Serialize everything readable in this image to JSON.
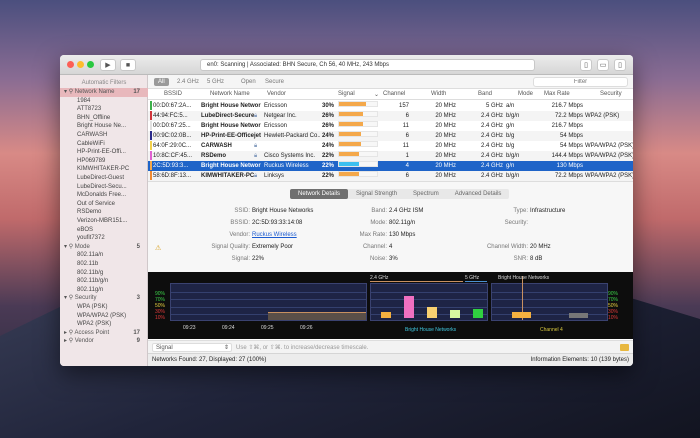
{
  "toolbar": {
    "status": "en0: Scanning  |  Associated: BHN Secure, Ch 56, 40 MHz, 243 Mbps",
    "play": "▶",
    "stop": "■"
  },
  "sidebar": {
    "header": "Automatic Filters",
    "items": [
      {
        "label": "Network Name",
        "count": "17",
        "group": true,
        "selected": true
      },
      {
        "label": "1984"
      },
      {
        "label": "ATT8723"
      },
      {
        "label": "BHN_Offline"
      },
      {
        "label": "Bright House Ne..."
      },
      {
        "label": "CARWASH"
      },
      {
        "label": "CableWiFi"
      },
      {
        "label": "HP-Print-EE-Offi..."
      },
      {
        "label": "HP069789"
      },
      {
        "label": "KIMWHITAKER-PC"
      },
      {
        "label": "LubeDirect-Guest"
      },
      {
        "label": "LubeDirect-Secu..."
      },
      {
        "label": "McDonalds Free..."
      },
      {
        "label": "Out of Service"
      },
      {
        "label": "RSDemo"
      },
      {
        "label": "Verizon-MBR151..."
      },
      {
        "label": "eBOS"
      },
      {
        "label": "youfit7372"
      },
      {
        "label": "Mode",
        "count": "5",
        "group": true
      },
      {
        "label": "802.11a/n"
      },
      {
        "label": "802.11b"
      },
      {
        "label": "802.11b/g"
      },
      {
        "label": "802.11b/g/n"
      },
      {
        "label": "802.11g/n"
      },
      {
        "label": "Security",
        "count": "3",
        "group": true
      },
      {
        "label": "WPA (PSK)"
      },
      {
        "label": "WPA/WPA2 (PSK)"
      },
      {
        "label": "WPA2 (PSK)"
      },
      {
        "label": "Access Point",
        "count": "17",
        "group": true,
        "collapsed": true
      },
      {
        "label": "Vendor",
        "count": "9",
        "group": true,
        "collapsed": true
      }
    ]
  },
  "filters": {
    "items": [
      "All",
      "2.4 GHz",
      "5 GHz",
      "Open",
      "Secure"
    ],
    "search_placeholder": "Filter"
  },
  "table": {
    "headers": [
      "BSSID",
      "Network Name",
      "Vendor",
      "Signal",
      "Channel",
      "Width",
      "Band",
      "Mode",
      "Max Rate",
      "Security"
    ],
    "rows": [
      {
        "bssid": "00:D0:67:2A...",
        "name": "Bright House Networks",
        "lock": false,
        "vendor": "Ericsson",
        "signal": "30%",
        "sig": 30,
        "channel": "157",
        "width": "20 MHz",
        "band": "5 GHz",
        "mode": "a/n",
        "rate": "216.7 Mbps",
        "security": "",
        "color": "#3cb04a"
      },
      {
        "bssid": "44:94:FC:5...",
        "name": "LubeDirect-Secure",
        "lock": true,
        "vendor": "Netgear Inc.",
        "signal": "26%",
        "sig": 26,
        "channel": "6",
        "width": "20 MHz",
        "band": "2.4 GHz",
        "mode": "b/g/n",
        "rate": "72.2 Mbps",
        "security": "WPA2 (PSK)",
        "color": "#d0343a"
      },
      {
        "bssid": "00:D0:67:25...",
        "name": "Bright House Networks",
        "lock": false,
        "vendor": "Ericsson",
        "signal": "26%",
        "sig": 26,
        "channel": "11",
        "width": "20 MHz",
        "band": "2.4 GHz",
        "mode": "g/n",
        "rate": "216.7 Mbps",
        "security": "",
        "color": "#e0e0e0"
      },
      {
        "bssid": "00:9C:02:0B...",
        "name": "HP-Print-EE-Officejet 6...",
        "lock": false,
        "vendor": "Hewlett-Packard Co...",
        "signal": "24%",
        "sig": 24,
        "channel": "6",
        "width": "20 MHz",
        "band": "2.4 GHz",
        "mode": "b/g",
        "rate": "54 Mbps",
        "security": "",
        "color": "#2a2a8a"
      },
      {
        "bssid": "64:0F:29:0C...",
        "name": "CARWASH",
        "lock": true,
        "vendor": "",
        "signal": "24%",
        "sig": 24,
        "channel": "11",
        "width": "20 MHz",
        "band": "2.4 GHz",
        "mode": "b/g",
        "rate": "54 Mbps",
        "security": "WPA/WPA2 (PSK)",
        "color": "#f2d04a"
      },
      {
        "bssid": "10:8C:CF:45...",
        "name": "RSDemo",
        "lock": true,
        "vendor": "Cisco Systems Inc.",
        "signal": "22%",
        "sig": 22,
        "channel": "1",
        "width": "20 MHz",
        "band": "2.4 GHz",
        "mode": "b/g/n",
        "rate": "144.4 Mbps",
        "security": "WPA/WPA2 (PSK)",
        "color": "#e060d0"
      },
      {
        "bssid": "2C:5D:93:3...",
        "name": "Bright House Networks",
        "lock": false,
        "vendor": "Ruckus Wireless",
        "signal": "22%",
        "sig": 22,
        "channel": "4",
        "width": "20 MHz",
        "band": "2.4 GHz",
        "mode": "g/n",
        "rate": "130 Mbps",
        "security": "",
        "color": "#f4a84a",
        "selected": true
      },
      {
        "bssid": "58:6D:8F:13...",
        "name": "KIMWHITAKER-PC",
        "lock": true,
        "vendor": "Linksys",
        "signal": "22%",
        "sig": 22,
        "channel": "6",
        "width": "20 MHz",
        "band": "2.4 GHz",
        "mode": "b/g/n",
        "rate": "72.2 Mbps",
        "security": "WPA/WPA2 (PSK)",
        "color": "#f08a30"
      }
    ]
  },
  "detail_tabs": [
    "Network Details",
    "Signal Strength",
    "Spectrum",
    "Advanced Details"
  ],
  "details": {
    "ssid_l": "SSID:",
    "ssid": "Bright House Networks",
    "bssid_l": "BSSID:",
    "bssid": "2C:5D:93:33:14:08",
    "vendor_l": "Vendor:",
    "vendor": "Ruckus Wireless",
    "quality_l": "Signal Quality:",
    "quality": "Extremely Poor",
    "signal_l": "Signal:",
    "signal": "22%",
    "band_l": "Band:",
    "band": "2.4 GHz ISM",
    "mode_l": "Mode:",
    "mode": "802.11g/n",
    "rate_l": "Max Rate:",
    "rate": "130 Mbps",
    "channel_l": "Channel:",
    "channel": "4",
    "noise_l": "Noise:",
    "noise": "3%",
    "type_l": "Type:",
    "type": "Infrastructure",
    "security_l": "Security:",
    "security": "",
    "cw_l": "Channel Width:",
    "cw": "20 MHz",
    "snr_l": "SNR:",
    "snr": "8 dB"
  },
  "graphs": {
    "y_labels": [
      "90%",
      "70%",
      "50%",
      "30%",
      "10%"
    ],
    "y_colors": [
      "#3cd04a",
      "#3cd04a",
      "#e8d040",
      "#e03a3a",
      "#e03a3a"
    ],
    "time_ticks": [
      "09:23",
      "09:24",
      "09:25",
      "09:26"
    ],
    "band_labels": [
      "2.4 GHz",
      "5 GHz"
    ],
    "spectrum_label": "Bright House Networks",
    "spectrum_bars": [
      {
        "v": 18,
        "c": "#f4b040"
      },
      {
        "v": 62,
        "c": "#f070c0"
      },
      {
        "v": 30,
        "c": "#f8d070"
      },
      {
        "v": 22,
        "c": "#d8f8a0"
      },
      {
        "v": 24,
        "c": "#30d040"
      }
    ],
    "channel_title": "Bright House Networks",
    "channel_label": "Channel 4",
    "channel_bars": [
      {
        "v": 18,
        "c": "#f4b040"
      },
      {
        "v": 15,
        "c": "#777"
      }
    ]
  },
  "bottom": {
    "select": "Signal",
    "hint": "Use ⇧⌘, or ⇧⌘. to increase/decrease timescale."
  },
  "statusbar": {
    "left": "Networks Found: 27, Displayed: 27 (100%)",
    "right": "Information Elements: 10 (139 bytes)"
  }
}
